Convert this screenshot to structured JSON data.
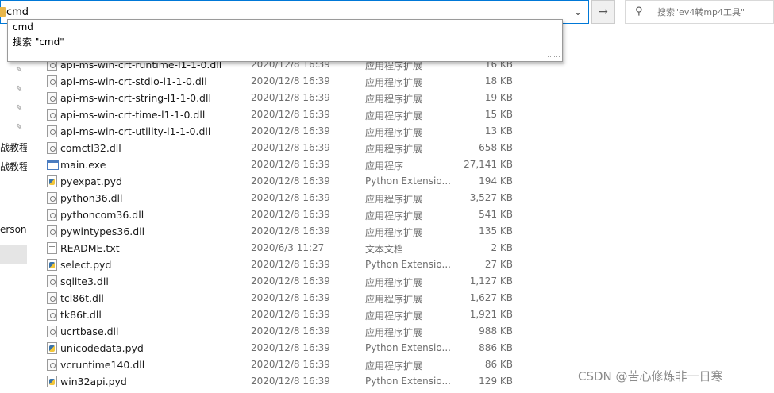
{
  "address_bar": {
    "value": "cmd"
  },
  "search": {
    "placeholder": "搜索\"ev4转mp4工具\""
  },
  "autocomplete": {
    "items": [
      "cmd",
      "搜索 \"cmd\""
    ]
  },
  "nav": {
    "labels": [
      "战教程",
      "战教程",
      "ersona"
    ]
  },
  "files": [
    {
      "name": "api-ms-win-crt-runtime-l1-1-0.dll",
      "date": "2020/12/8 16:39",
      "type": "应用程序扩展",
      "size": "16 KB",
      "icon": "dll-file-icon"
    },
    {
      "name": "api-ms-win-crt-stdio-l1-1-0.dll",
      "date": "2020/12/8 16:39",
      "type": "应用程序扩展",
      "size": "18 KB",
      "icon": "dll-file-icon"
    },
    {
      "name": "api-ms-win-crt-string-l1-1-0.dll",
      "date": "2020/12/8 16:39",
      "type": "应用程序扩展",
      "size": "19 KB",
      "icon": "dll-file-icon"
    },
    {
      "name": "api-ms-win-crt-time-l1-1-0.dll",
      "date": "2020/12/8 16:39",
      "type": "应用程序扩展",
      "size": "15 KB",
      "icon": "dll-file-icon"
    },
    {
      "name": "api-ms-win-crt-utility-l1-1-0.dll",
      "date": "2020/12/8 16:39",
      "type": "应用程序扩展",
      "size": "13 KB",
      "icon": "dll-file-icon"
    },
    {
      "name": "comctl32.dll",
      "date": "2020/12/8 16:39",
      "type": "应用程序扩展",
      "size": "658 KB",
      "icon": "dll-file-icon"
    },
    {
      "name": "main.exe",
      "date": "2020/12/8 16:39",
      "type": "应用程序",
      "size": "27,141 KB",
      "icon": "exe-file-icon"
    },
    {
      "name": "pyexpat.pyd",
      "date": "2020/12/8 16:39",
      "type": "Python Extensio...",
      "size": "194 KB",
      "icon": "python-file-icon"
    },
    {
      "name": "python36.dll",
      "date": "2020/12/8 16:39",
      "type": "应用程序扩展",
      "size": "3,527 KB",
      "icon": "dll-file-icon"
    },
    {
      "name": "pythoncom36.dll",
      "date": "2020/12/8 16:39",
      "type": "应用程序扩展",
      "size": "541 KB",
      "icon": "dll-file-icon"
    },
    {
      "name": "pywintypes36.dll",
      "date": "2020/12/8 16:39",
      "type": "应用程序扩展",
      "size": "135 KB",
      "icon": "dll-file-icon"
    },
    {
      "name": "README.txt",
      "date": "2020/6/3 11:27",
      "type": "文本文档",
      "size": "2 KB",
      "icon": "text-file-icon"
    },
    {
      "name": "select.pyd",
      "date": "2020/12/8 16:39",
      "type": "Python Extensio...",
      "size": "27 KB",
      "icon": "python-file-icon"
    },
    {
      "name": "sqlite3.dll",
      "date": "2020/12/8 16:39",
      "type": "应用程序扩展",
      "size": "1,127 KB",
      "icon": "dll-file-icon"
    },
    {
      "name": "tcl86t.dll",
      "date": "2020/12/8 16:39",
      "type": "应用程序扩展",
      "size": "1,627 KB",
      "icon": "dll-file-icon"
    },
    {
      "name": "tk86t.dll",
      "date": "2020/12/8 16:39",
      "type": "应用程序扩展",
      "size": "1,921 KB",
      "icon": "dll-file-icon"
    },
    {
      "name": "ucrtbase.dll",
      "date": "2020/12/8 16:39",
      "type": "应用程序扩展",
      "size": "988 KB",
      "icon": "dll-file-icon"
    },
    {
      "name": "unicodedata.pyd",
      "date": "2020/12/8 16:39",
      "type": "Python Extensio...",
      "size": "886 KB",
      "icon": "python-file-icon"
    },
    {
      "name": "vcruntime140.dll",
      "date": "2020/12/8 16:39",
      "type": "应用程序扩展",
      "size": "86 KB",
      "icon": "dll-file-icon"
    },
    {
      "name": "win32api.pyd",
      "date": "2020/12/8 16:39",
      "type": "Python Extensio...",
      "size": "129 KB",
      "icon": "python-file-icon"
    }
  ],
  "watermark": "CSDN @苦心修炼非一日寒"
}
